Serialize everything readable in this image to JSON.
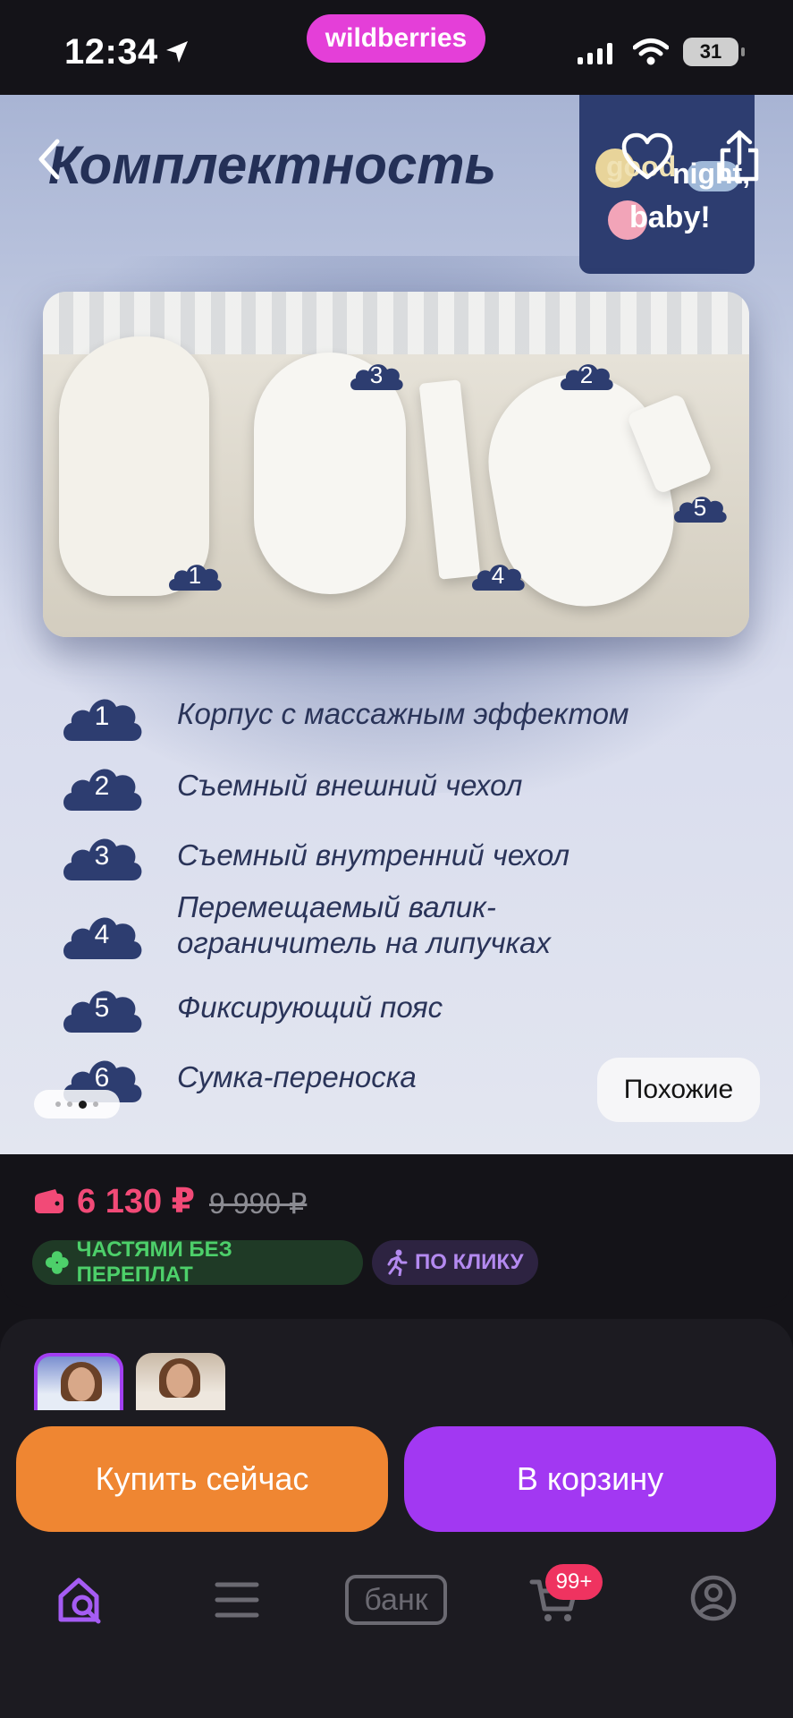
{
  "status_bar": {
    "time": "12:34",
    "brand": "wildberries",
    "battery": "31"
  },
  "gallery": {
    "title": "Комплектность",
    "logo": {
      "line1": "good",
      "line2": "night,",
      "line3": "baby!"
    },
    "photo_labels": [
      "1",
      "2",
      "3",
      "4",
      "5"
    ],
    "legend": [
      {
        "num": "1",
        "text": "Корпус с массажным эффектом"
      },
      {
        "num": "2",
        "text": "Съемный внешний чехол"
      },
      {
        "num": "3",
        "text": "Съемный внутренний чехол"
      },
      {
        "num": "4",
        "text": "Перемещаемый валик-\nограничитель на липучках"
      },
      {
        "num": "5",
        "text": "Фиксирующий пояс"
      },
      {
        "num": "6",
        "text": "Сумка-переноска"
      }
    ],
    "similar_label": "Похожие",
    "page_index": 3,
    "page_count": 4
  },
  "price": {
    "current": "6 130 ₽",
    "old": "9 990 ₽",
    "badges": [
      {
        "label": "ЧАСТЯМИ БЕЗ ПЕРЕПЛАТ",
        "icon": "clover-icon"
      },
      {
        "label": "ПО КЛИКУ",
        "icon": "running-person-icon"
      }
    ]
  },
  "actions": {
    "buy_now": "Купить сейчас",
    "add_to_cart": "В корзину"
  },
  "tabbar": {
    "bank_label": "банк",
    "cart_count": "99+"
  },
  "colors": {
    "brand": "#e43fd8",
    "price": "#f24a77",
    "buy_now": "#ef8632",
    "add_to_cart": "#a238f2",
    "cart_badge": "#ef3360",
    "navy": "#2a3459"
  }
}
